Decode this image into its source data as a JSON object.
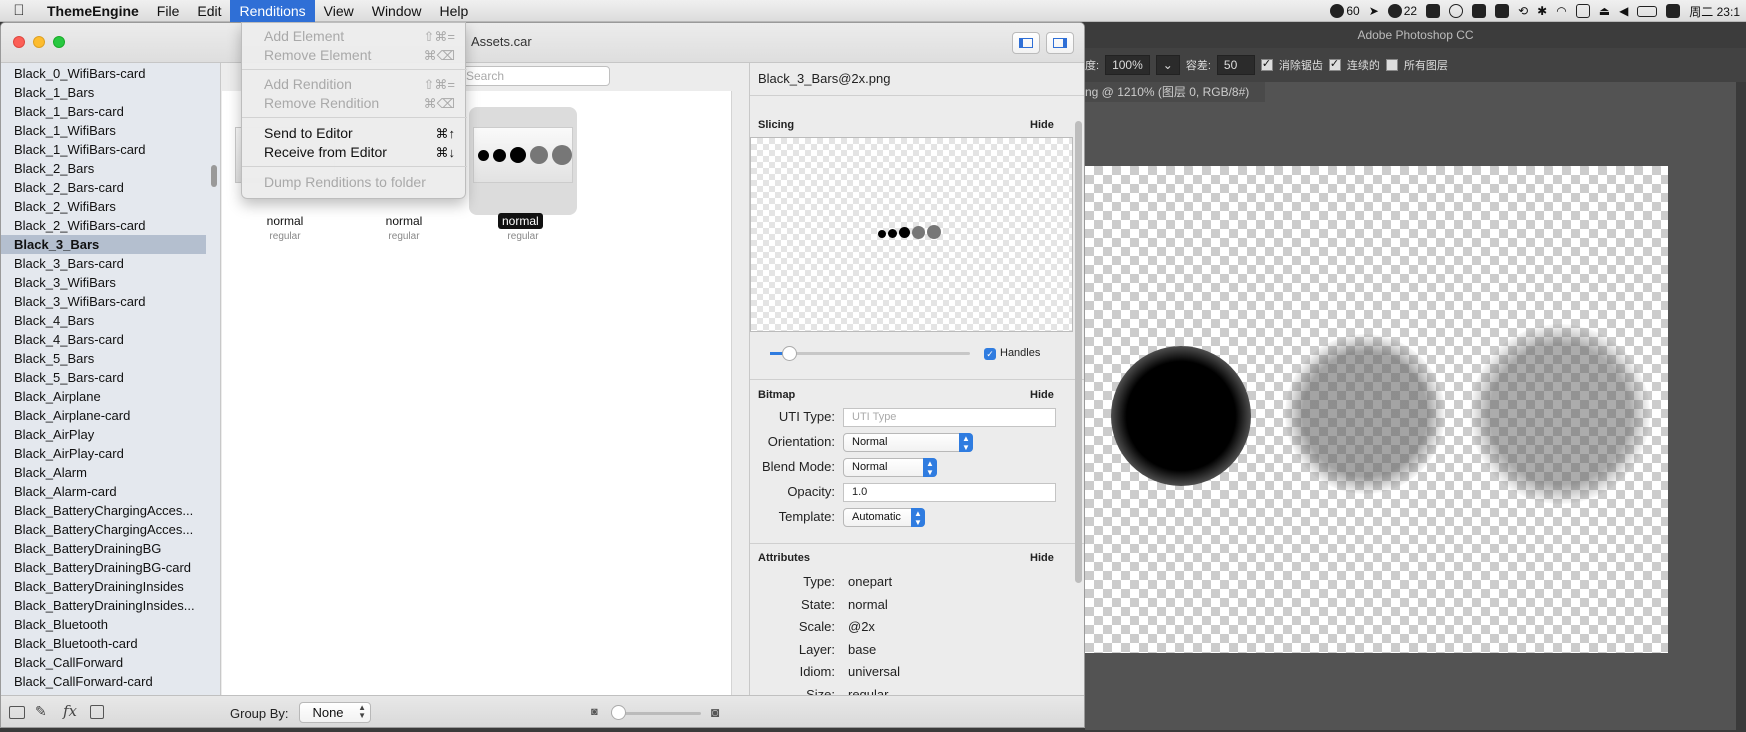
{
  "menubar": {
    "app": "ThemeEngine",
    "items": [
      "File",
      "Edit",
      "Renditions",
      "View",
      "Window",
      "Help"
    ],
    "active": "Renditions"
  },
  "status": {
    "item1": "60",
    "item2": "22",
    "clock": "周二 23:1"
  },
  "renditions_menu": {
    "items": [
      {
        "label": "Add Element",
        "shortcut": "⇧⌘=",
        "enabled": false
      },
      {
        "label": "Remove Element",
        "shortcut": "⌘⌫",
        "enabled": false
      },
      {
        "label": "Add Rendition",
        "shortcut": "⇧⌘=",
        "enabled": false
      },
      {
        "label": "Remove Rendition",
        "shortcut": "⌘⌫",
        "enabled": false
      },
      {
        "label": "Send to Editor",
        "shortcut": "⌘↑",
        "enabled": true
      },
      {
        "label": "Receive from Editor",
        "shortcut": "⌘↓",
        "enabled": true
      },
      {
        "label": "Dump Renditions to folder",
        "shortcut": "",
        "enabled": false
      }
    ]
  },
  "window": {
    "title": "Assets.car",
    "search_placeholder": "Search"
  },
  "sidebar": {
    "items": [
      "Black_0_WifiBars-card",
      "Black_1_Bars",
      "Black_1_Bars-card",
      "Black_1_WifiBars",
      "Black_1_WifiBars-card",
      "Black_2_Bars",
      "Black_2_Bars-card",
      "Black_2_WifiBars",
      "Black_2_WifiBars-card",
      "Black_3_Bars",
      "Black_3_Bars-card",
      "Black_3_WifiBars",
      "Black_3_WifiBars-card",
      "Black_4_Bars",
      "Black_4_Bars-card",
      "Black_5_Bars",
      "Black_5_Bars-card",
      "Black_Airplane",
      "Black_Airplane-card",
      "Black_AirPlay",
      "Black_AirPlay-card",
      "Black_Alarm",
      "Black_Alarm-card",
      "Black_BatteryChargingAcces...",
      "Black_BatteryChargingAcces...",
      "Black_BatteryDrainingBG",
      "Black_BatteryDrainingBG-card",
      "Black_BatteryDrainingInsides",
      "Black_BatteryDrainingInsides...",
      "Black_Bluetooth",
      "Black_Bluetooth-card",
      "Black_CallForward",
      "Black_CallForward-card"
    ],
    "selected_index": 9
  },
  "renditions": [
    {
      "state": "normal",
      "sub": "regular"
    },
    {
      "state": "normal",
      "sub": "regular"
    },
    {
      "state": "normal",
      "sub": "regular"
    }
  ],
  "inspector": {
    "filename": "Black_3_Bars@2x.png",
    "slicing": {
      "title": "Slicing",
      "hide": "Hide",
      "handles_label": "Handles",
      "handles_checked": true
    },
    "bitmap": {
      "title": "Bitmap",
      "hide": "Hide",
      "uti_label": "UTI Type:",
      "uti_placeholder": "UTI Type",
      "orientation_label": "Orientation:",
      "orientation": "Normal",
      "blend_label": "Blend Mode:",
      "blend": "Normal",
      "opacity_label": "Opacity:",
      "opacity": "1.0",
      "template_label": "Template:",
      "template": "Automatic"
    },
    "attributes": {
      "title": "Attributes",
      "hide": "Hide",
      "rows": [
        {
          "label": "Type:",
          "value": "onepart"
        },
        {
          "label": "State:",
          "value": "normal"
        },
        {
          "label": "Scale:",
          "value": "@2x"
        },
        {
          "label": "Layer:",
          "value": "base"
        },
        {
          "label": "Idiom:",
          "value": "universal"
        },
        {
          "label": "Size:",
          "value": "regular"
        }
      ]
    }
  },
  "bottombar": {
    "group_by_label": "Group By:",
    "group_by": "None"
  },
  "photoshop": {
    "title": "Adobe Photoshop CC",
    "zoom_label": "度:",
    "zoom": "100%",
    "tolerance_label": "容差:",
    "tolerance": "50",
    "antialias_label": "消除锯齿",
    "contiguous_label": "连续的",
    "all_layers_label": "所有图层",
    "doc_tab": "ng @ 1210% (图层 0, RGB/8#)"
  },
  "colors": {
    "menu_highlight": "#2f6fd6",
    "selection": "#b4bfcf",
    "popup_accent": "#2f7ce0"
  }
}
